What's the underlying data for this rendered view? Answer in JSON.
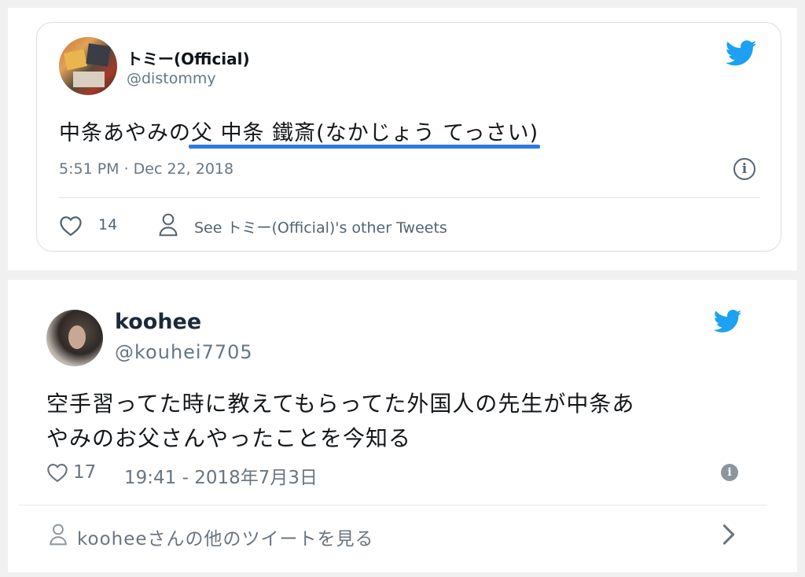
{
  "tweet1": {
    "display_name": "トミー(Official)",
    "handle": "@distommy",
    "text": "中条あやみの父 中条 鐵斎(なかじょう てっさい)",
    "timestamp": "5:51 PM · Dec 22, 2018",
    "likes": "14",
    "see_other": "See トミー(Official)'s other Tweets",
    "info_glyph": "i",
    "underline_color": "#2d7ae6",
    "bird_color": "#1da1f2"
  },
  "tweet2": {
    "display_name": "koohee",
    "handle": "@kouhei7705",
    "text_line1": "空手習ってた時に教えてもらってた外国人の先生が中条あ",
    "text_line2": "やみのお父さんやったことを今知る",
    "likes": "17",
    "timestamp": "19:41 - 2018年7月3日",
    "see_other": "kooheeさんの他のツイートを見る",
    "info_glyph": "i",
    "bird_color": "#1da1f2"
  }
}
